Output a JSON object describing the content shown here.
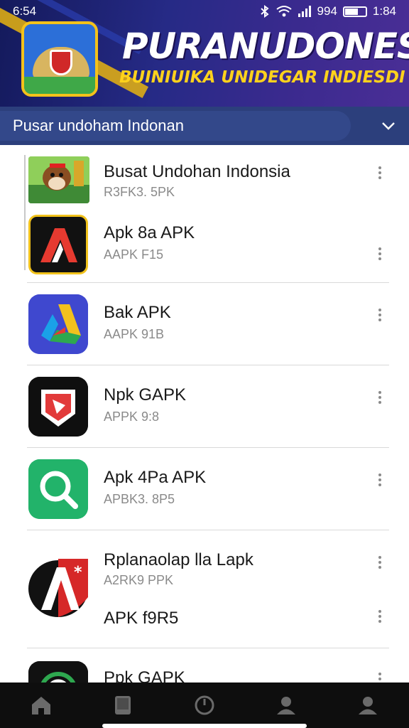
{
  "status_bar": {
    "time": "6:54",
    "signal_text": "994",
    "clock_right": "1:84"
  },
  "header": {
    "brand_title": "PURANUDONESIA",
    "brand_subtitle": "BUINIUIKA UNIDEGAR INDIESDI"
  },
  "dropdown": {
    "label": "Pusar undoham Indonan"
  },
  "apps": [
    {
      "title": "Busat Undohan Indonsia",
      "subtitle": "R3FK3. 5PK"
    },
    {
      "title": "Apk 8a APK",
      "subtitle": "AAPK F15"
    },
    {
      "title": "Bak APK",
      "subtitle": "AAPK 91B"
    },
    {
      "title": "Npk GAPK",
      "subtitle": "APPK 9:8"
    },
    {
      "title": "Apk 4Pa APK",
      "subtitle": "APBK3. 8P5"
    },
    {
      "title": "Rplanaolap lla Lapk",
      "subtitle": "A2RK9 PPK"
    },
    {
      "title": "APK f9R5",
      "subtitle": ""
    },
    {
      "title": "Ppk GAPK",
      "subtitle": ""
    }
  ],
  "icons": {
    "app_icon_1": "cartoon-dog-icon",
    "app_icon_2": "adobe-a-icon",
    "app_icon_3": "google-drive-icon",
    "app_icon_4": "map-marker-icon",
    "app_icon_5": "search-magnifier-icon",
    "app_icon_6": "a-star-shield-icon",
    "app_icon_7": "circle-logo-icon",
    "nav": [
      "home-icon",
      "bookmark-icon",
      "power-clock-icon",
      "person-icon",
      "account-icon"
    ]
  },
  "colors": {
    "header_dark": "#141a5c",
    "header_purple": "#4a2e96",
    "accent_yellow": "#ffd21c",
    "dropdown_bg": "#2c3f7c",
    "nav_bg": "#0e0e0e"
  }
}
